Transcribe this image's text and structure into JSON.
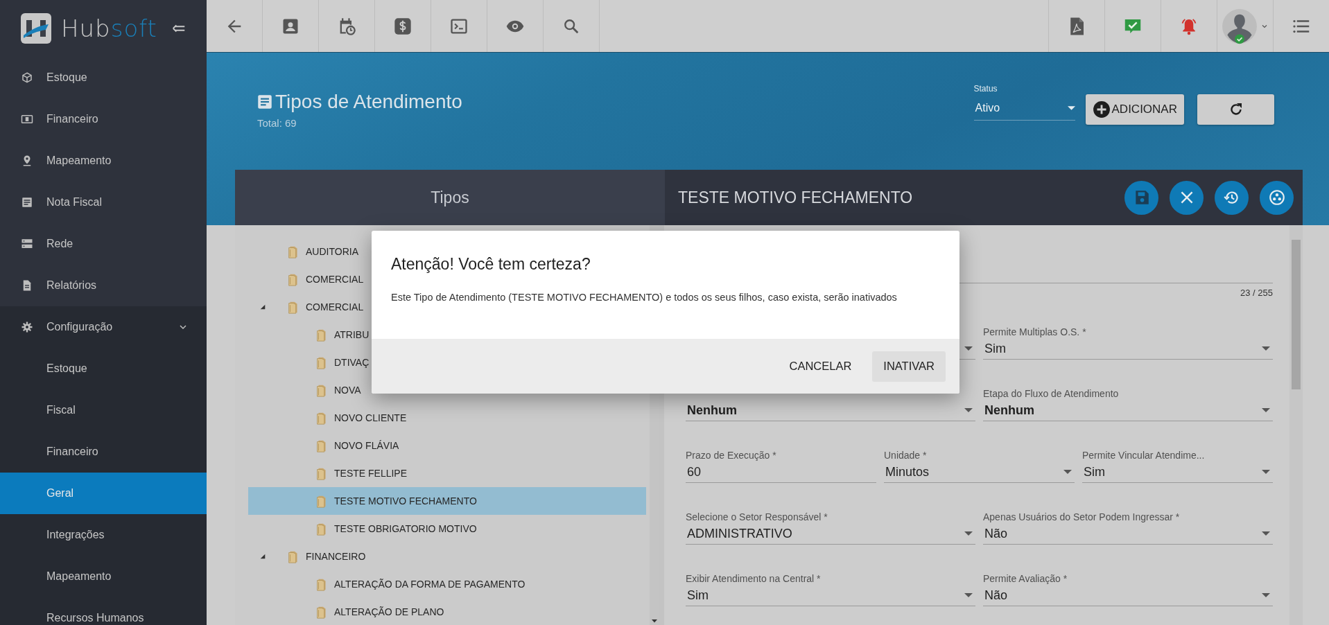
{
  "sidebar": {
    "logo": {
      "parts": [
        {
          "text": "Hub",
          "accent": false
        },
        {
          "text": "soft",
          "accent": true
        }
      ]
    },
    "items": [
      {
        "label": "Estoque",
        "kind": "box",
        "selected": false
      },
      {
        "label": "Financeiro",
        "kind": "money",
        "selected": false
      },
      {
        "label": "Mapeamento",
        "kind": "pin",
        "selected": false
      },
      {
        "label": "Nota Fiscal",
        "kind": "list",
        "selected": false
      },
      {
        "label": "Rede",
        "kind": "server",
        "selected": false
      },
      {
        "label": "Relatórios",
        "kind": "doc",
        "selected": false
      },
      {
        "label": "Configuração",
        "kind": "gear",
        "selected": false,
        "expanded": true,
        "children": [
          {
            "label": "Estoque",
            "selected": false
          },
          {
            "label": "Fiscal",
            "selected": false
          },
          {
            "label": "Financeiro",
            "selected": false
          },
          {
            "label": "Geral",
            "selected": true
          },
          {
            "label": "Integrações",
            "selected": false
          },
          {
            "label": "Mapeamento",
            "selected": false
          },
          {
            "label": "Recursos Humanos",
            "selected": false
          }
        ]
      }
    ]
  },
  "page": {
    "title": "Tipos de Atendimento",
    "total": "Total: 69",
    "status": {
      "label": "Status",
      "value": "Ativo"
    },
    "buttons": [
      {
        "kind": "add",
        "label": "ADICIONAR"
      },
      {
        "kind": "refresh"
      }
    ]
  },
  "panel": {
    "left_title": "Tipos",
    "right_title": "TESTE MOTIVO FECHAMENTO",
    "actions": [
      {
        "kind": "save"
      },
      {
        "kind": "close"
      },
      {
        "kind": "history"
      },
      {
        "kind": "more"
      }
    ]
  },
  "tree": [
    {
      "label": "AUDITORIA",
      "selected": false
    },
    {
      "label": "COMERCIAL",
      "selected": false
    },
    {
      "label": "COMERCIAL",
      "selected": false,
      "expanded": true,
      "children": [
        {
          "label": "ATRIBU",
          "selected": false
        },
        {
          "label": "DTIVAÇ",
          "selected": false
        },
        {
          "label": "NOVA",
          "selected": false
        },
        {
          "label": "NOVO CLIENTE",
          "selected": false
        },
        {
          "label": "NOVO FLÁVIA",
          "selected": false
        },
        {
          "label": "TESTE FELLIPE",
          "selected": false
        },
        {
          "label": "TESTE MOTIVO FECHAMENTO",
          "selected": true
        },
        {
          "label": "TESTE OBRIGATORIO MOTIVO",
          "selected": false
        }
      ]
    },
    {
      "label": "FINANCEIRO",
      "selected": false,
      "expanded": true,
      "children": [
        {
          "label": "ALTERAÇÃO DA FORMA DE PAGAMENTO",
          "selected": false
        },
        {
          "label": "ALTERAÇÃO DE PLANO",
          "selected": false
        }
      ]
    }
  ],
  "form": {
    "rows": [
      [
        {
          "kind": "text",
          "counter": "23 / 255"
        }
      ],
      [
        {
          "kind": "select"
        },
        {
          "kind": "select",
          "label": "Permite Multiplas O.S. *",
          "value": "Sim",
          "bold": false
        }
      ],
      [
        {
          "kind": "select",
          "value": "Nenhum",
          "bold": true
        },
        {
          "kind": "select",
          "label": "Etapa do Fluxo de Atendimento",
          "value": "Nenhum",
          "bold": true
        }
      ],
      [
        {
          "kind": "text",
          "label": "Prazo de Execução *",
          "value": "60",
          "bold": false
        },
        {
          "kind": "select",
          "label": "Unidade *",
          "value": "Minutos",
          "bold": false
        },
        {
          "kind": "select",
          "label": "Permite Vincular Atendime...",
          "value": "Sim",
          "bold": false
        }
      ],
      [
        {
          "kind": "select",
          "label": "Selecione o Setor Responsável *",
          "value": "ADMINISTRATIVO",
          "bold": false
        },
        {
          "kind": "select",
          "label": "Apenas Usuários do Setor Podem Ingressar *",
          "value": "Não",
          "bold": false
        }
      ],
      [
        {
          "kind": "select",
          "label": "Exibir Atendimento na Central *",
          "value": "Sim",
          "bold": false
        },
        {
          "kind": "select",
          "label": "Permite Avaliação *",
          "value": "Não",
          "bold": false
        }
      ]
    ]
  },
  "dialog": {
    "title": "Atenção! Você tem certeza?",
    "message": "Este Tipo de Atendimento (TESTE MOTIVO FECHAMENTO) e todos os seus filhos, caso exista, serão inativados",
    "buttons": [
      {
        "label": "CANCELAR",
        "kind": "flat"
      },
      {
        "label": "INATIVAR",
        "kind": "raised"
      }
    ]
  }
}
